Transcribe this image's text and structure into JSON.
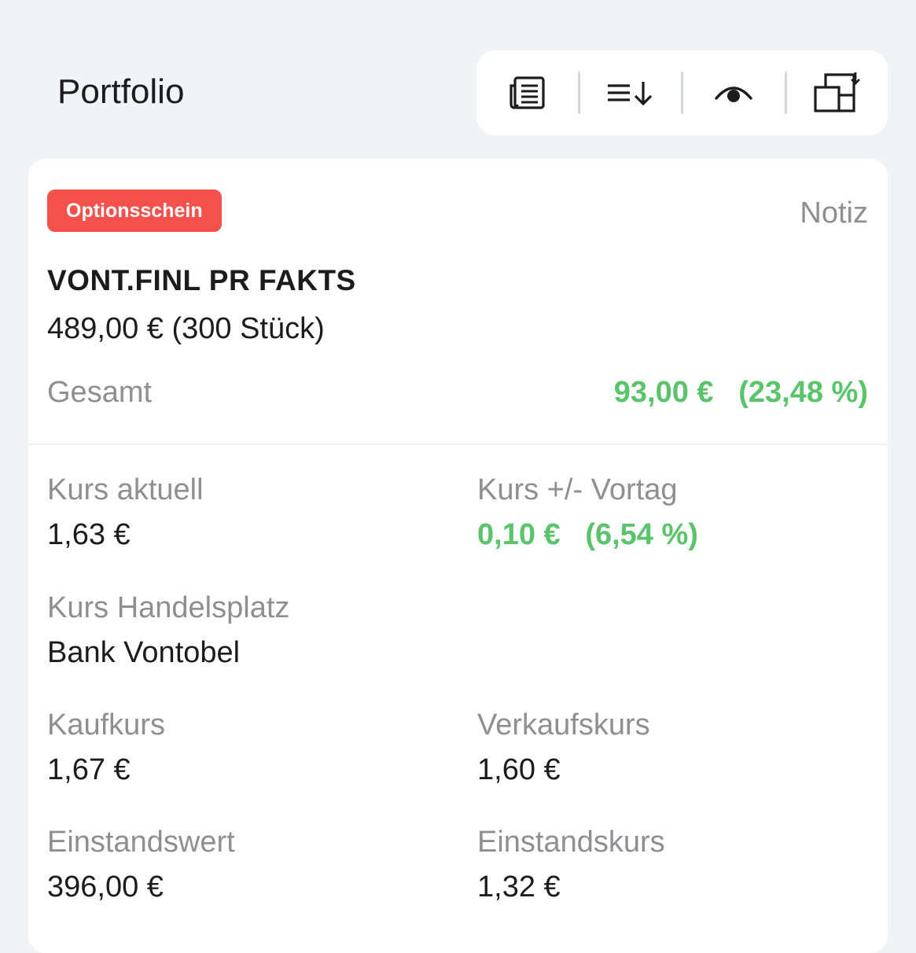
{
  "header": {
    "title": "Portfolio",
    "toolbar": [
      {
        "icon": "news-icon"
      },
      {
        "icon": "sort-icon"
      },
      {
        "icon": "visibility-icon"
      },
      {
        "icon": "export-icon"
      }
    ]
  },
  "position": {
    "badge": "Optionsschein",
    "note_label": "Notiz",
    "name": "VONT.FINL PR FAKTS",
    "value_line": "489,00 € (300 Stück)",
    "total_label": "Gesamt",
    "total_value": "93,00 €   (23,48 %)"
  },
  "details": {
    "kurs_aktuell": {
      "label": "Kurs aktuell",
      "value": "1,63 €"
    },
    "kurs_vortag": {
      "label": "Kurs +/- Vortag",
      "value": "0,10 €   (6,54 %)"
    },
    "kurs_handelsplatz": {
      "label": "Kurs Handelsplatz",
      "value": "Bank Vontobel"
    },
    "kaufkurs": {
      "label": "Kaufkurs",
      "value": "1,67 €"
    },
    "verkaufskurs": {
      "label": "Verkaufskurs",
      "value": "1,60 €"
    },
    "einstandswert": {
      "label": "Einstandswert",
      "value": "396,00 €"
    },
    "einstandskurs": {
      "label": "Einstandskurs",
      "value": "1,32 €"
    }
  },
  "colors": {
    "badge": "#f4504c",
    "gain": "#5ac46b",
    "muted": "#8e8e93",
    "background": "#f2f3f6"
  }
}
